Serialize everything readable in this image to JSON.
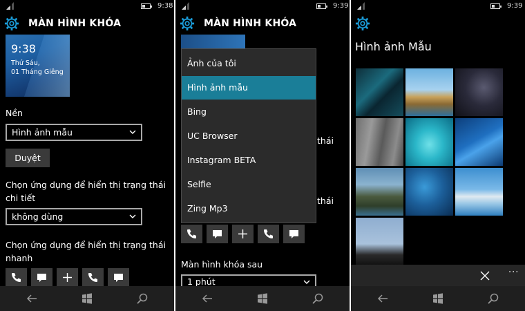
{
  "colors": {
    "accent": "#1a7e98",
    "background": "#000000",
    "tile": "#3a3a3a",
    "navbar": "#1f1f1f"
  },
  "panel1": {
    "status_time": "9:38",
    "header_title": "MÀN HÌNH KHÓA",
    "preview": {
      "time": "9:38",
      "day": "Thứ Sáu,",
      "date": "01 Tháng Giêng"
    },
    "background_label": "Nền",
    "background_value": "Hình ảnh mẫu",
    "browse_label": "Duyệt",
    "detail_label_line1": "Chọn ứng dụng để hiển thị trạng thái",
    "detail_label_line2": "chi tiết",
    "detail_value": "không dùng",
    "quick_label_line1": "Chọn ứng dụng để hiển thị trạng thái",
    "quick_label_line2": "nhanh",
    "quick_icons": [
      "phone-icon",
      "message-icon",
      "add-icon",
      "phone-icon",
      "message-icon"
    ]
  },
  "panel2": {
    "status_time": "9:39",
    "header_title": "MÀN HÌNH KHÓA",
    "menu_items": [
      "Ảnh của tôi",
      "Hình ảnh mẫu",
      "Bing",
      "UC Browser",
      "Instagram BETA",
      "Selfie",
      "Zing Mp3"
    ],
    "selected_index": 1,
    "peek_text_1": "thái",
    "peek_text_2": "thái",
    "timeout_label": "Màn hình khóa sau",
    "timeout_value": "1 phút"
  },
  "panel3": {
    "status_time": "9:39",
    "gallery_title": "Hình ảnh Mẫu",
    "more_label": "···"
  }
}
